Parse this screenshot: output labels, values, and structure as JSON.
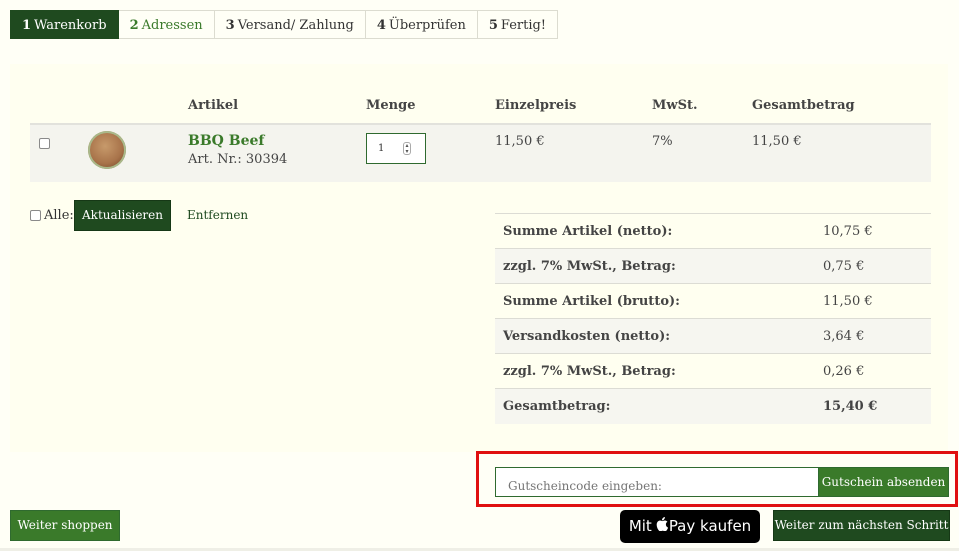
{
  "steps": [
    {
      "num": "1",
      "label": "Warenkorb"
    },
    {
      "num": "2",
      "label": "Adressen"
    },
    {
      "num": "3",
      "label": "Versand/ Zahlung"
    },
    {
      "num": "4",
      "label": "Überprüfen"
    },
    {
      "num": "5",
      "label": "Fertig!"
    }
  ],
  "cart": {
    "headers": {
      "artikel": "Artikel",
      "menge": "Menge",
      "einzelpreis": "Einzelpreis",
      "mwst": "MwSt.",
      "gesamtbetrag": "Gesamtbetrag"
    },
    "item": {
      "name": "BBQ Beef",
      "art_nr": "Art. Nr.: 30394",
      "quantity": "1",
      "unit_price": "11,50 €",
      "vat": "7%",
      "total": "11,50 €"
    }
  },
  "actions": {
    "all_label": "Alle:",
    "update_label": "Aktualisieren",
    "remove_label": "Entfernen"
  },
  "totals": [
    {
      "label": "Summe Artikel (netto):",
      "value": "10,75 €"
    },
    {
      "label": "zzgl. 7% MwSt., Betrag:",
      "value": "0,75 €"
    },
    {
      "label": "Summe Artikel (brutto):",
      "value": "11,50 €"
    },
    {
      "label": "Versandkosten (netto):",
      "value": "3,64 €"
    },
    {
      "label": "zzgl. 7% MwSt., Betrag:",
      "value": "0,26 €"
    },
    {
      "label": "Gesamtbetrag:",
      "value": "15,40 €"
    }
  ],
  "coupon": {
    "placeholder": "Gutscheincode eingeben:",
    "button_label": "Gutschein absenden"
  },
  "footer": {
    "continue_shopping": "Weiter shoppen",
    "applepay_prefix": "Mit",
    "applepay_pay": "Pay",
    "applepay_suffix": "kaufen",
    "next_step": "Weiter zum nächsten Schritt"
  },
  "colors": {
    "dark_green": "#1f4a1f",
    "green": "#3a7a2a",
    "highlight_red": "#e01010",
    "background": "#fffff6"
  }
}
